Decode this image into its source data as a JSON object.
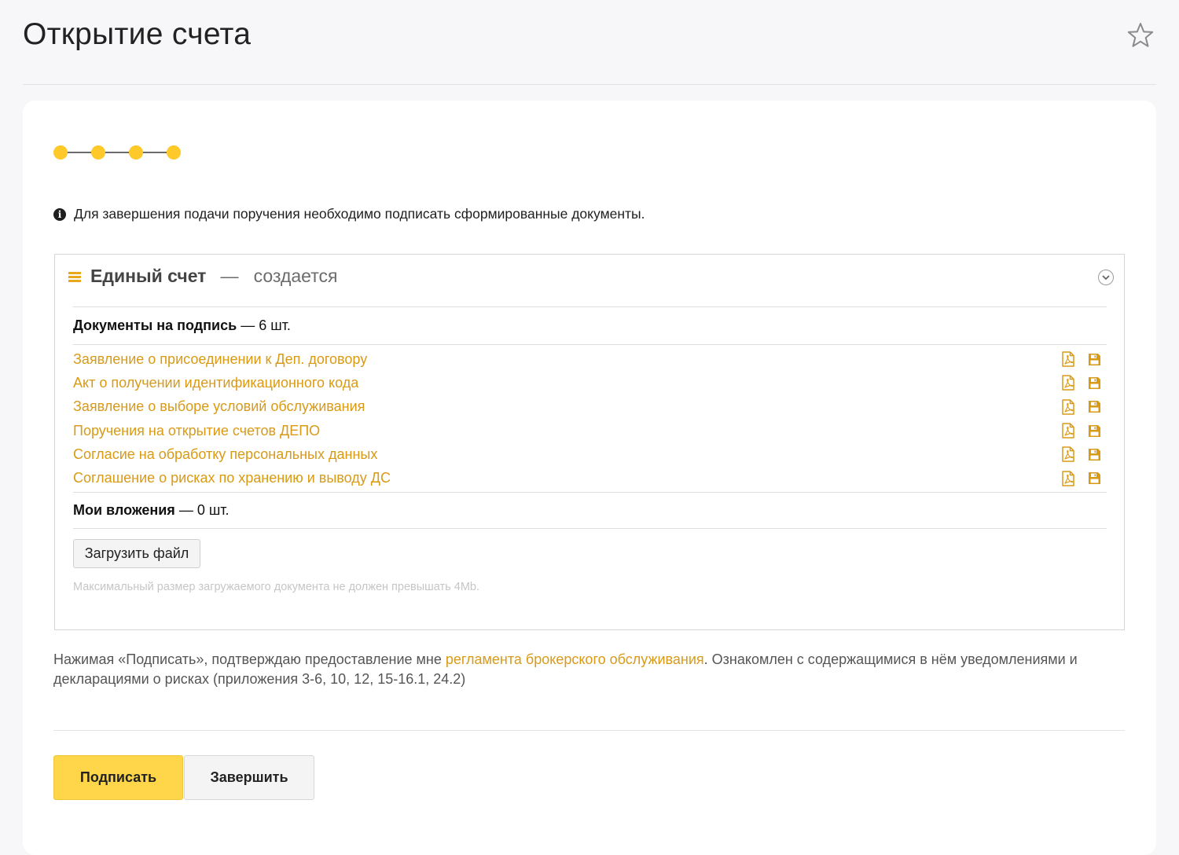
{
  "page": {
    "title": "Открытие счета"
  },
  "header": {
    "favorite_icon": "star-icon"
  },
  "stepper": {
    "steps_total": 4,
    "steps_completed": 4,
    "dot_color": "#ffc92a"
  },
  "info": {
    "icon": "info-circle-icon",
    "text": "Для завершения подачи поручения необходимо подписать сформированные документы."
  },
  "panel": {
    "icon": "hamburger-icon",
    "name": "Единый счет",
    "dash": "—",
    "status": "создается",
    "toggle_icon": "chevron-down-icon",
    "documents": {
      "label": "Документы на подпись",
      "count_text": " — 6 шт.",
      "items": [
        {
          "title": "Заявление о присоединении к Деп. договору"
        },
        {
          "title": "Акт о получении идентификационного кода"
        },
        {
          "title": "Заявление о выборе условий обслуживания"
        },
        {
          "title": "Поручения на открытие счетов ДЕПО"
        },
        {
          "title": "Согласие на обработку персональных данных"
        },
        {
          "title": "Соглашение о рисках по хранению и выводу ДС"
        }
      ],
      "pdf_icon": "pdf-file-icon",
      "save_icon": "save-floppy-icon"
    },
    "attachments": {
      "label": "Мои вложения",
      "count_text": " — 0 шт."
    },
    "upload_button": "Загрузить файл",
    "upload_hint": "Максимальный размер загружаемого документа не должен превышать 4Mb."
  },
  "consent": {
    "before": "Нажимая «Подписать», подтверждаю предоставление мне ",
    "link": "регламента брокерского обслуживания",
    "after": ". Ознакомлен с содержащимися в нём уведомлениями и декларациями о рисках (приложения 3-6, 10, 12, 15-16.1, 24.2)"
  },
  "actions": {
    "sign": "Подписать",
    "finish": "Завершить"
  },
  "colors": {
    "accent": "#d99a16",
    "primary_button": "#ffd54a",
    "background": "#f7f7f9"
  }
}
